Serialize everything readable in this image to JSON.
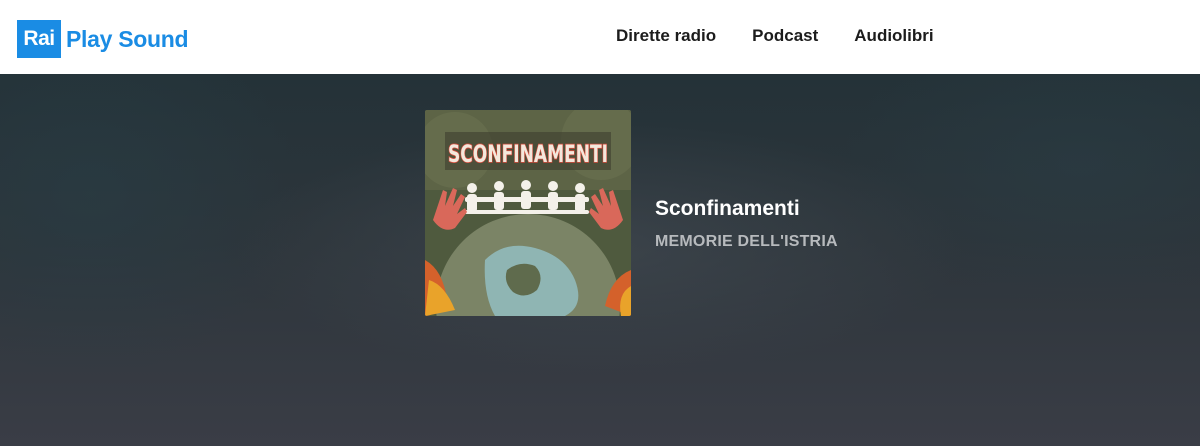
{
  "header": {
    "logo": {
      "box_text": "Rai",
      "text": "Play Sound",
      "color": "#1a8ce4"
    },
    "nav": [
      {
        "label": "Dirette radio"
      },
      {
        "label": "Podcast"
      },
      {
        "label": "Audiolibri"
      }
    ]
  },
  "show": {
    "cover_title": "SCONFINAMENTI",
    "title": "Sconfinamenti",
    "subtitle": "MEMORIE DELL'ISTRIA"
  }
}
